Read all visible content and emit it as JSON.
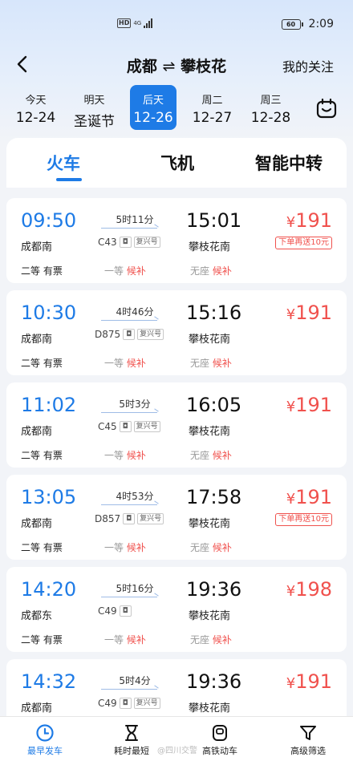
{
  "status": {
    "hd": "HD",
    "signal": "4G",
    "battery": "60",
    "time": "2:09"
  },
  "nav": {
    "title_from": "成都",
    "title_sep": "⇌",
    "title_to": "攀枝花",
    "follow": "我的关注"
  },
  "dates": [
    {
      "label": "今天",
      "date": "12-24"
    },
    {
      "label": "明天",
      "date": "圣诞节"
    },
    {
      "label": "后天",
      "date": "12-26"
    },
    {
      "label": "周二",
      "date": "12-27"
    },
    {
      "label": "周三",
      "date": "12-28"
    }
  ],
  "tabs": {
    "train": "火车",
    "plane": "飞机",
    "transfer": "智能中转"
  },
  "common": {
    "price_symbol": "¥",
    "candidate": "候补",
    "first_class": "一等",
    "no_seat": "无座",
    "fuxing": "复兴号"
  },
  "trains": [
    {
      "dep": "09:50",
      "duration": "5时11分",
      "number": "C43",
      "arr": "15:01",
      "from": "成都南",
      "to": "攀枝花南",
      "price": "191",
      "promo": "下单再送10元",
      "second": "二等 有票"
    },
    {
      "dep": "10:30",
      "duration": "4时46分",
      "number": "D875",
      "arr": "15:16",
      "from": "成都南",
      "to": "攀枝花南",
      "price": "191",
      "promo": "",
      "second": "二等 有票"
    },
    {
      "dep": "11:02",
      "duration": "5时3分",
      "number": "C45",
      "arr": "16:05",
      "from": "成都南",
      "to": "攀枝花南",
      "price": "191",
      "promo": "",
      "second": "二等 有票"
    },
    {
      "dep": "13:05",
      "duration": "4时53分",
      "number": "D857",
      "arr": "17:58",
      "from": "成都南",
      "to": "攀枝花南",
      "price": "191",
      "promo": "下单再送10元",
      "second": "二等 有票"
    },
    {
      "dep": "14:20",
      "duration": "5时16分",
      "number": "C49",
      "arr": "19:36",
      "from": "成都东",
      "to": "攀枝花南",
      "price": "198",
      "promo": "",
      "second": "二等 有票"
    },
    {
      "dep": "14:32",
      "duration": "5时4分",
      "number": "C49",
      "arr": "19:36",
      "from": "成都南",
      "to": "攀枝花南",
      "price": "191",
      "promo": "",
      "second": ""
    }
  ],
  "bottom_nav": {
    "earliest": "最早发车",
    "shortest": "耗时最短",
    "high_speed": "高铁动车",
    "filter": "高级筛选"
  },
  "watermark": "@四川交警"
}
